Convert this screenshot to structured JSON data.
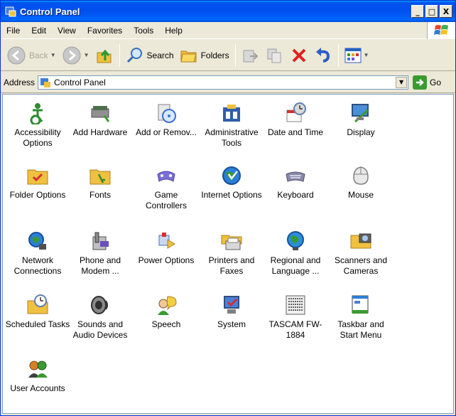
{
  "window": {
    "title": "Control Panel"
  },
  "title_buttons": [
    "_",
    "□",
    "X"
  ],
  "menu": [
    "File",
    "Edit",
    "View",
    "Favorites",
    "Tools",
    "Help"
  ],
  "toolbar": {
    "back_label": "Back",
    "search_label": "Search",
    "folders_label": "Folders"
  },
  "address": {
    "label": "Address",
    "value": "Control Panel",
    "go_label": "Go"
  },
  "items": [
    {
      "label": "Accessibility Options",
      "icon": "accessibility-icon",
      "color": "#2e8b2e"
    },
    {
      "label": "Add Hardware",
      "icon": "add-hardware-icon",
      "color": "#4f6f4f"
    },
    {
      "label": "Add or Remov...",
      "icon": "add-remove-programs-icon",
      "color": "#3a6fd8"
    },
    {
      "label": "Administrative Tools",
      "icon": "admin-tools-icon",
      "color": "#2f5fa8"
    },
    {
      "label": "Date and Time",
      "icon": "date-time-icon",
      "color": "#d8d8d8"
    },
    {
      "label": "Display",
      "icon": "display-icon",
      "color": "#4a8fd8"
    },
    {
      "label": "Folder Options",
      "icon": "folder-options-icon",
      "color": "#f0c040"
    },
    {
      "label": "Fonts",
      "icon": "fonts-icon",
      "color": "#f0c040"
    },
    {
      "label": "Game Controllers",
      "icon": "game-controllers-icon",
      "color": "#7a6fd8"
    },
    {
      "label": "Internet Options",
      "icon": "internet-options-icon",
      "color": "#2a7fd8"
    },
    {
      "label": "Keyboard",
      "icon": "keyboard-icon",
      "color": "#8888a8"
    },
    {
      "label": "Mouse",
      "icon": "mouse-icon",
      "color": "#e8e8e8"
    },
    {
      "label": "Network Connections",
      "icon": "network-connections-icon",
      "color": "#2a7fd8"
    },
    {
      "label": "Phone and Modem ...",
      "icon": "phone-modem-icon",
      "color": "#888888"
    },
    {
      "label": "Power Options",
      "icon": "power-options-icon",
      "color": "#4a6fb8"
    },
    {
      "label": "Printers and Faxes",
      "icon": "printers-faxes-icon",
      "color": "#f0c040"
    },
    {
      "label": "Regional and Language ...",
      "icon": "regional-language-icon",
      "color": "#2a8fd8"
    },
    {
      "label": "Scanners and Cameras",
      "icon": "scanners-cameras-icon",
      "color": "#f0c040"
    },
    {
      "label": "Scheduled Tasks",
      "icon": "scheduled-tasks-icon",
      "color": "#f0c040"
    },
    {
      "label": "Sounds and Audio Devices",
      "icon": "sounds-audio-icon",
      "color": "#888888"
    },
    {
      "label": "Speech",
      "icon": "speech-icon",
      "color": "#3a9a31"
    },
    {
      "label": "System",
      "icon": "system-icon",
      "color": "#4a7fd8"
    },
    {
      "label": "TASCAM FW-1884",
      "icon": "tascam-icon",
      "color": "#b8b8b8"
    },
    {
      "label": "Taskbar and Start Menu",
      "icon": "taskbar-start-menu-icon",
      "color": "#2a7fd8"
    },
    {
      "label": "User Accounts",
      "icon": "user-accounts-icon",
      "color": "#d87f2a"
    }
  ]
}
